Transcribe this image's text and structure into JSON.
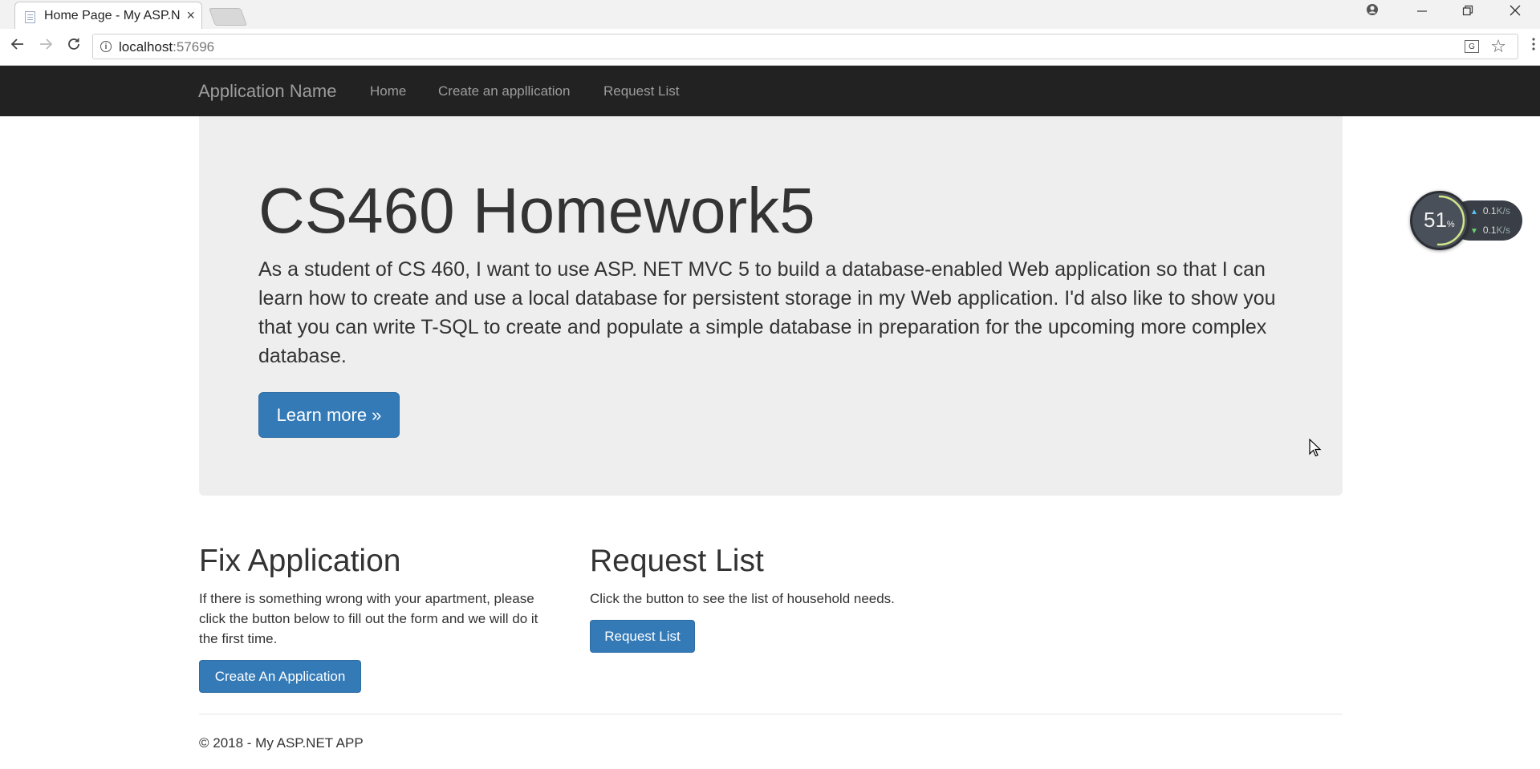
{
  "browser": {
    "tab_title": "Home Page - My ASP.N",
    "tab_close": "×",
    "url_host": "localhost",
    "url_port": ":57696"
  },
  "navbar": {
    "brand": "Application Name",
    "links": [
      "Home",
      "Create an appllication",
      "Request List"
    ]
  },
  "jumbotron": {
    "title": "CS460 Homework5",
    "text": "As a student of CS 460, I want to use ASP. NET MVC 5 to build a database-enabled Web application so that I can learn how to create and use a local database for persistent storage in my Web application. I'd also like to show you that you can write T-SQL to create and populate a simple database in preparation for the upcoming more complex database.",
    "button_label": "Learn more »"
  },
  "columns": [
    {
      "title": "Fix Application",
      "text": "If there is something wrong with your apartment, please click the button below to fill out the form and we will do it the first time.",
      "button_label": "Create An Application"
    },
    {
      "title": "Request List",
      "text": "Click the button to see the list of household needs.",
      "button_label": "Request List"
    }
  ],
  "footer": {
    "text": "© 2018 - My ASP.NET APP"
  },
  "net_widget": {
    "percent": "51",
    "percent_unit": "%",
    "percent_value": 0.51,
    "upload_rate": "0.1",
    "download_rate": "0.1",
    "rate_unit": "K/s"
  },
  "colors": {
    "navbar_bg": "#222222",
    "jumbotron_bg": "#eeeeee",
    "primary_button": "#337ab7"
  }
}
